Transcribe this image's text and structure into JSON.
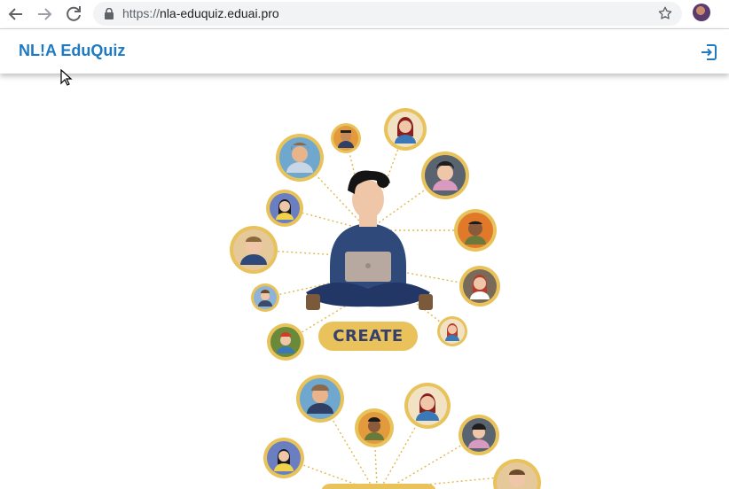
{
  "browser": {
    "url_protocol": "https://",
    "url_host": "nla-eduquiz.eduai.pro",
    "icons": [
      "back-arrow-icon",
      "forward-arrow-icon",
      "reload-icon",
      "lock-icon",
      "star-icon",
      "profile-avatar"
    ]
  },
  "header": {
    "title": "NL!A EduQuiz",
    "logout_icon": "logout-icon",
    "accent_color": "#1f7ac2"
  },
  "illustration": {
    "create_label": "CREATE",
    "banner_color": "#e9c25b",
    "banner_text_color": "#37406a",
    "ring_color": "#e8c25a"
  }
}
